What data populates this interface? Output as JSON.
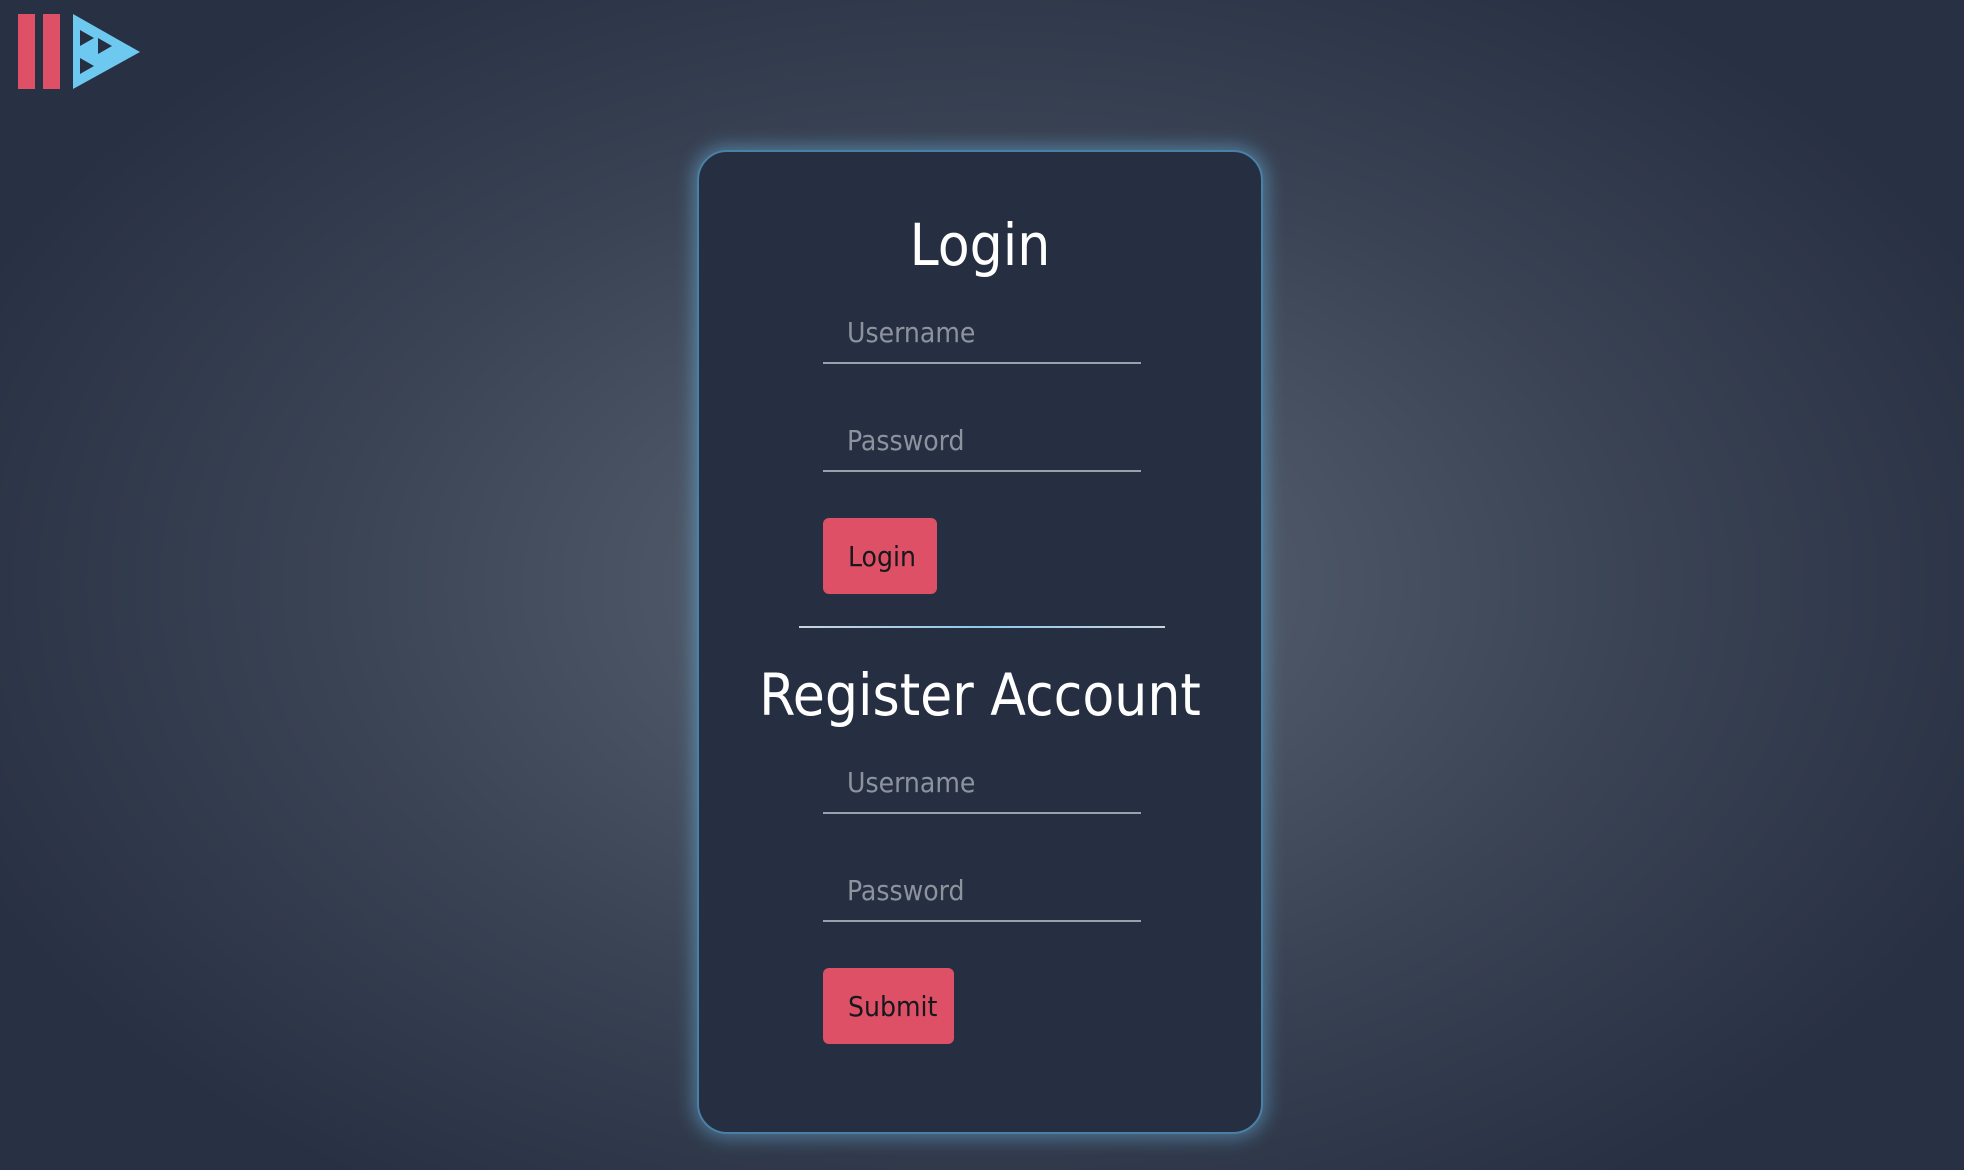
{
  "login": {
    "title": "Login",
    "username_placeholder": "Username",
    "password_placeholder": "Password",
    "button_label": "Login"
  },
  "register": {
    "title": "Register Account",
    "username_placeholder": "Username",
    "password_placeholder": "Password",
    "button_label": "Submit"
  },
  "logo": {
    "icon": "logo-icon",
    "bar_color": "#de5066",
    "triangle_color": "#6ec9f1"
  },
  "colors": {
    "accent": "#de5066",
    "card_background": "#262f41",
    "card_glow": "#6ebef0"
  }
}
